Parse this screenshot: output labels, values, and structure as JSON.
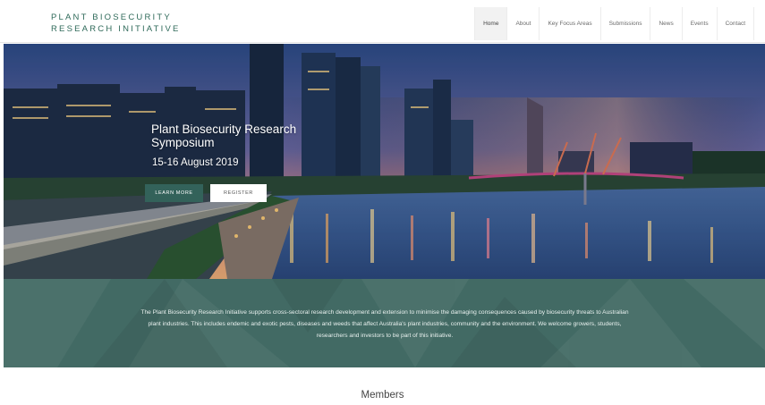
{
  "logo": {
    "line1": "PLANT BIOSECURITY",
    "line2": "RESEARCH INITIATIVE"
  },
  "nav": {
    "items": [
      {
        "label": "Home",
        "active": true
      },
      {
        "label": "About",
        "active": false
      },
      {
        "label": "Key Focus Areas",
        "active": false
      },
      {
        "label": "Submissions",
        "active": false
      },
      {
        "label": "News",
        "active": false
      },
      {
        "label": "Events",
        "active": false
      },
      {
        "label": "Contact",
        "active": false
      }
    ]
  },
  "hero": {
    "title": "Plant Biosecurity Research Symposium",
    "date": "15-16 August 2019",
    "learn_more_label": "LEARN MORE",
    "register_label": "REGISTER"
  },
  "intro": {
    "text": "The Plant Biosecurity Research Initiative supports cross-sectoral research development and extension to minimise the damaging consequences caused by biosecurity threats to Australian plant industries. This includes endemic and exotic pests, diseases and weeds that affect Australia's plant industries, community and the environment.  We welcome growers, students, researchers and investors to be part of this initiative."
  },
  "members": {
    "title": "Members"
  },
  "colors": {
    "brand_green": "#2f6a5a",
    "button_green": "#33625a",
    "intro_band": "#426a64"
  }
}
